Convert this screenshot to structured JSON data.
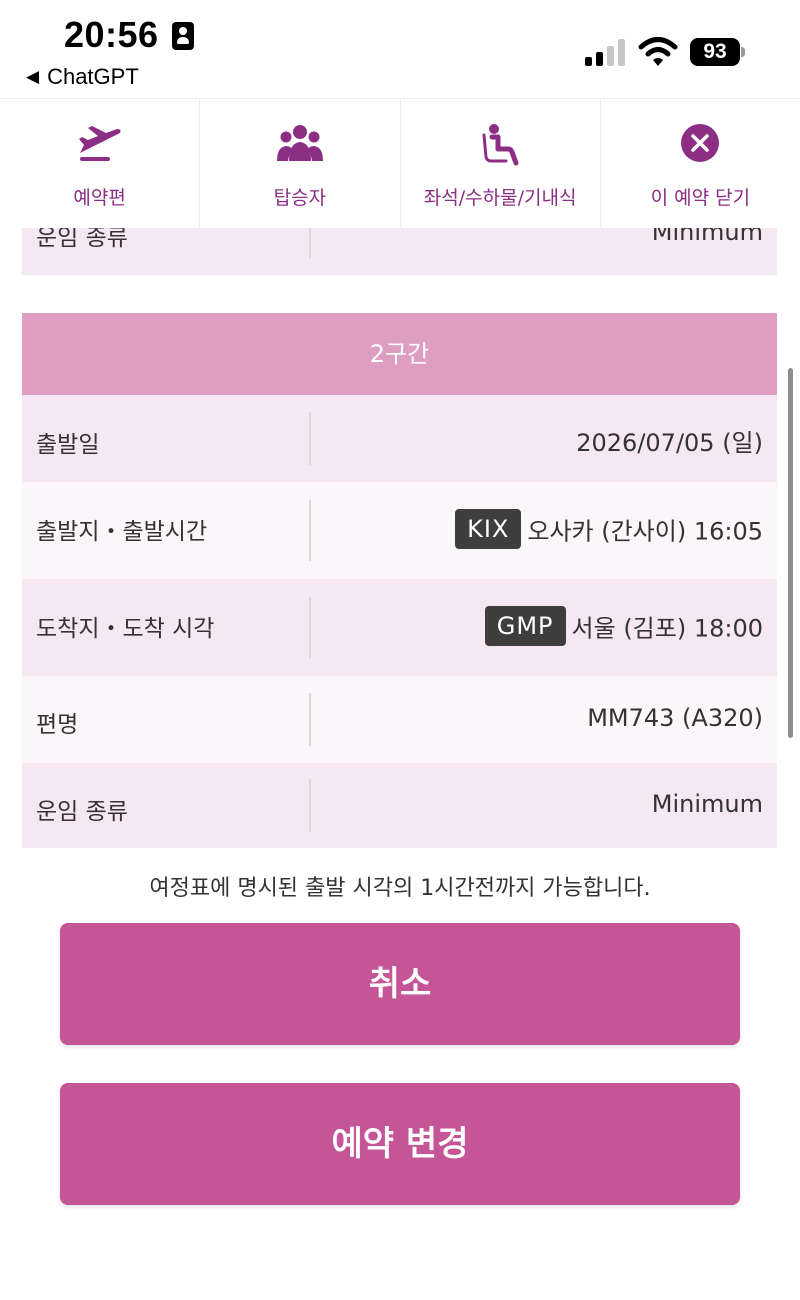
{
  "status_bar": {
    "time": "20:56",
    "back_app": "ChatGPT",
    "battery": "93"
  },
  "tabs": [
    {
      "label": "예약편",
      "icon": "airplane-icon"
    },
    {
      "label": "탑승자",
      "icon": "group-icon"
    },
    {
      "label": "좌석/수하물/기내식",
      "icon": "seat-icon"
    },
    {
      "label": "이 예약 닫기",
      "icon": "close-circle-icon"
    }
  ],
  "partial_row": {
    "label": "운임 종류",
    "value": "Minimum"
  },
  "segment2": {
    "header": "2구간",
    "departure_date": {
      "label": "출발일",
      "value": "2026/07/05 (일)"
    },
    "origin": {
      "label": "출발지・출발시간",
      "code": "KIX",
      "value": "오사카 (간사이) 16:05"
    },
    "destination": {
      "label": "도착지・도착 시각",
      "code": "GMP",
      "value": "서울 (김포) 18:00"
    },
    "flight": {
      "label": "편명",
      "value": "MM743 (A320)"
    },
    "fare": {
      "label": "운임 종류",
      "value": "Minimum"
    }
  },
  "note": "여정표에 명시된 출발 시각의 1시간전까지 가능합니다.",
  "buttons": {
    "cancel": "취소",
    "change": "예약 변경"
  },
  "colors": {
    "accent": "#8c2f84",
    "button": "#c45596",
    "section_header": "#de9ec1",
    "row_pink": "#f6e8f3",
    "row_light": "#faf6f9"
  }
}
